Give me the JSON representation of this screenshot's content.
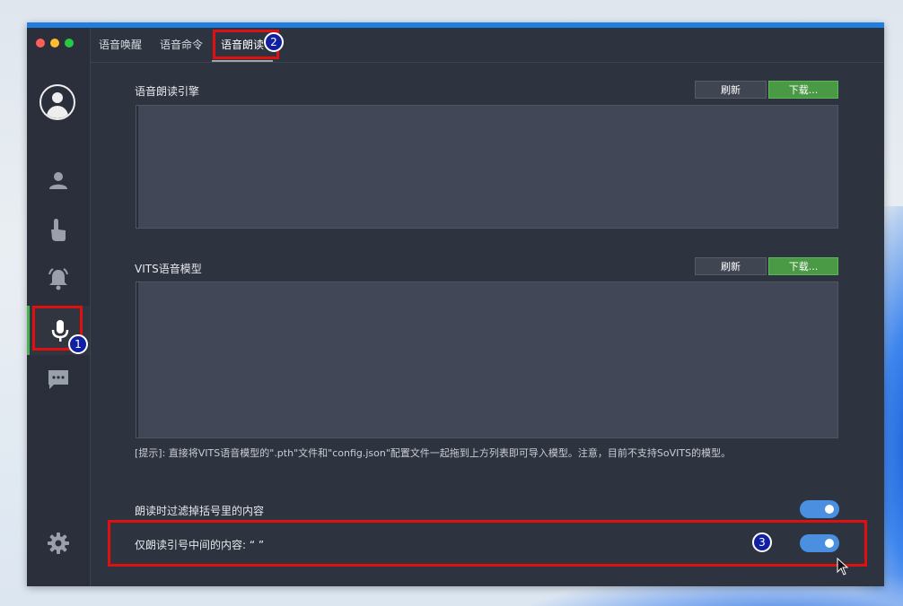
{
  "tabs": [
    {
      "label": "语音唤醒"
    },
    {
      "label": "语音命令"
    },
    {
      "label": "语音朗读"
    }
  ],
  "tts_engine": {
    "title": "语音朗读引擎",
    "refresh_label": "刷新",
    "download_label": "下载..."
  },
  "vits_model": {
    "title": "VITS语音模型",
    "refresh_label": "刷新",
    "download_label": "下载...",
    "hint": "[提示]: 直接将VITS语音模型的\".pth\"文件和\"config.json\"配置文件一起拖到上方列表即可导入模型。注意，目前不支持SoVITS的模型。"
  },
  "settings": [
    {
      "label": "朗读时过滤掉括号里的内容",
      "enabled": true
    },
    {
      "label": "仅朗读引号中间的内容: “ ”",
      "enabled": true
    }
  ],
  "annotations": {
    "badge1": "1",
    "badge2": "2",
    "badge3": "3"
  },
  "colors": {
    "accent": "#1f7fe0",
    "active_indicator": "#4caf50",
    "download_button": "#4a9a45",
    "toggle_on": "#4a8fe0",
    "highlight": "#e01010"
  },
  "icons": {
    "sidebar": [
      "user-icon",
      "touch-icon",
      "bell-icon",
      "microphone-icon",
      "chat-icon",
      "gear-icon"
    ]
  }
}
